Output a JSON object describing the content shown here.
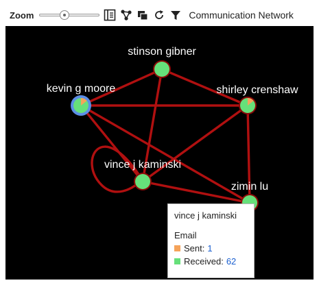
{
  "toolbar": {
    "zoom_label": "Zoom",
    "zoom_level": 0.4,
    "title": "Communication Network",
    "icons": [
      "legend-panel-icon",
      "network-layout-icon",
      "copy-windows-icon",
      "refresh-icon",
      "filter-icon"
    ]
  },
  "network": {
    "background": "#000000",
    "edge_color": "#b01010",
    "node_border_color": "#8b0a0a",
    "highlight_border_color": "#5b8ee6",
    "nodes": [
      {
        "id": "stinson",
        "label": "stinson gibner",
        "sent_color": "#66e07a",
        "received_color": "#66e07a"
      },
      {
        "id": "kevin",
        "label": "kevin g moore",
        "sent_color": "#f5a35a",
        "received_color": "#66e07a",
        "highlighted": true
      },
      {
        "id": "shirley",
        "label": "shirley crenshaw",
        "sent_color": "#f5a35a",
        "received_color": "#66e07a"
      },
      {
        "id": "vince",
        "label": "vince j kaminski",
        "sent_color": "#66e07a",
        "received_color": "#66e07a"
      },
      {
        "id": "zimin",
        "label": "zimin lu",
        "sent_color": "#66e07a",
        "received_color": "#66e07a"
      }
    ],
    "edges": [
      [
        "stinson",
        "kevin"
      ],
      [
        "stinson",
        "shirley"
      ],
      [
        "stinson",
        "vince"
      ],
      [
        "kevin",
        "shirley"
      ],
      [
        "kevin",
        "vince"
      ],
      [
        "kevin",
        "zimin"
      ],
      [
        "shirley",
        "vince"
      ],
      [
        "shirley",
        "zimin"
      ],
      [
        "vince",
        "zimin"
      ],
      [
        "vince",
        "vince"
      ]
    ]
  },
  "tooltip": {
    "name": "vince j kaminski",
    "section": "Email",
    "sent_label": "Sent:",
    "sent_value": "1",
    "received_label": "Received:",
    "received_value": "62",
    "sent_color": "#f5a35a",
    "received_color": "#66e07a"
  }
}
